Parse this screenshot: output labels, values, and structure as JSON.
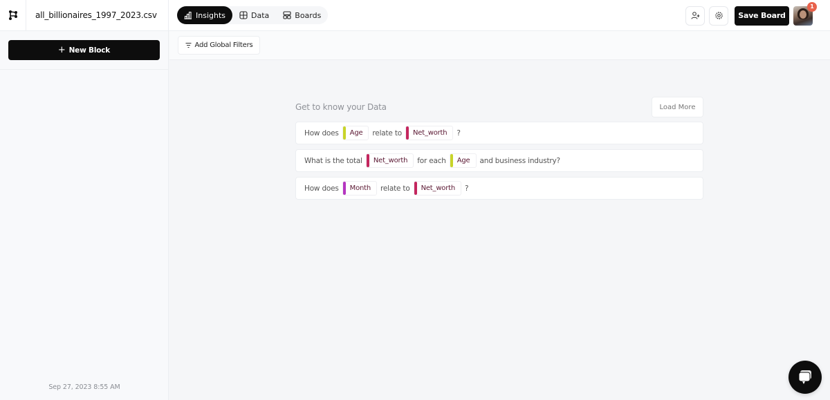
{
  "app": {
    "filename": "all_billionaires_1997_2023.csv",
    "logo_icon": "app-logo-icon"
  },
  "tabs": [
    {
      "label": "Insights",
      "icon": "bar-chart-icon",
      "active": true
    },
    {
      "label": "Data",
      "icon": "grid-icon",
      "active": false
    },
    {
      "label": "Boards",
      "icon": "boards-icon",
      "active": false
    }
  ],
  "toolbar": {
    "invite_icon": "add-user-icon",
    "settings_icon": "gear-icon",
    "save_label": "Save Board",
    "notification_count": "1"
  },
  "sidebar": {
    "new_block_label": "New Block",
    "timestamp": "Sep 27, 2023 8:55 AM"
  },
  "filters": {
    "add_label": "Add Global Filters"
  },
  "insights": {
    "title": "Get to know your Data",
    "load_more_label": "Load More",
    "questions": [
      {
        "parts": [
          {
            "type": "text",
            "value": "How does"
          },
          {
            "type": "chip",
            "value": "Age",
            "color": "#c8d42a"
          },
          {
            "type": "text",
            "value": "relate to"
          },
          {
            "type": "chip",
            "value": "Net_worth",
            "color": "#c4265e"
          },
          {
            "type": "text",
            "value": "?"
          }
        ]
      },
      {
        "parts": [
          {
            "type": "text",
            "value": "What is the total"
          },
          {
            "type": "chip",
            "value": "Net_worth",
            "color": "#c4265e"
          },
          {
            "type": "text",
            "value": "for each"
          },
          {
            "type": "chip",
            "value": "Age",
            "color": "#c8d42a"
          },
          {
            "type": "text",
            "value": "and business industry?"
          }
        ]
      },
      {
        "parts": [
          {
            "type": "text",
            "value": "How does"
          },
          {
            "type": "chip",
            "value": "Month",
            "color": "#b536c0"
          },
          {
            "type": "text",
            "value": "relate to"
          },
          {
            "type": "chip",
            "value": "Net_worth",
            "color": "#c4265e"
          },
          {
            "type": "text",
            "value": "?"
          }
        ]
      }
    ]
  },
  "chat": {
    "icon": "chat-bubble-icon"
  }
}
